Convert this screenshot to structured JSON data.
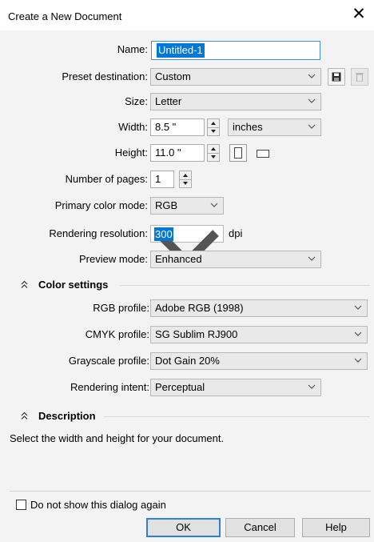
{
  "dialog": {
    "title": "Create a New Document",
    "close_glyph": "✕"
  },
  "form": {
    "name": {
      "label": "Name:",
      "value": "Untitled-1"
    },
    "preset": {
      "label": "Preset destination:",
      "value": "Custom"
    },
    "size": {
      "label": "Size:",
      "value": "Letter"
    },
    "width": {
      "label": "Width:",
      "value": "8.5 \"",
      "unit": "inches"
    },
    "height": {
      "label": "Height:",
      "value": "11.0 \""
    },
    "pages": {
      "label": "Number of pages:",
      "value": "1"
    },
    "color_mode": {
      "label": "Primary color mode:",
      "value": "RGB"
    },
    "resolution": {
      "label": "Rendering resolution:",
      "value": "300",
      "unit": "dpi"
    },
    "preview": {
      "label": "Preview mode:",
      "value": "Enhanced"
    }
  },
  "color_settings": {
    "header": "Color settings",
    "rgb_profile": {
      "label": "RGB profile:",
      "value": "Adobe RGB (1998)"
    },
    "cmyk_profile": {
      "label": "CMYK profile:",
      "value": "SG Sublim RJ900"
    },
    "grayscale_profile": {
      "label": "Grayscale profile:",
      "value": "Dot Gain 20%"
    },
    "rendering_intent": {
      "label": "Rendering intent:",
      "value": "Perceptual"
    }
  },
  "description": {
    "header": "Description",
    "text": "Select the width and height for your document."
  },
  "footer": {
    "dont_show_label": "Do not show this dialog again",
    "ok": "OK",
    "cancel": "Cancel",
    "help": "Help"
  },
  "colors": {
    "selection": "#0078d7",
    "name_border": "#3c8fdc",
    "default_button": "#2f7fd5"
  },
  "icons": [
    "close-icon",
    "chevron-down-icon",
    "save-preset-icon",
    "delete-preset-icon",
    "spin-up-icon",
    "spin-down-icon",
    "portrait-icon",
    "landscape-icon",
    "collapse-section-icon",
    "checkbox-icon"
  ]
}
